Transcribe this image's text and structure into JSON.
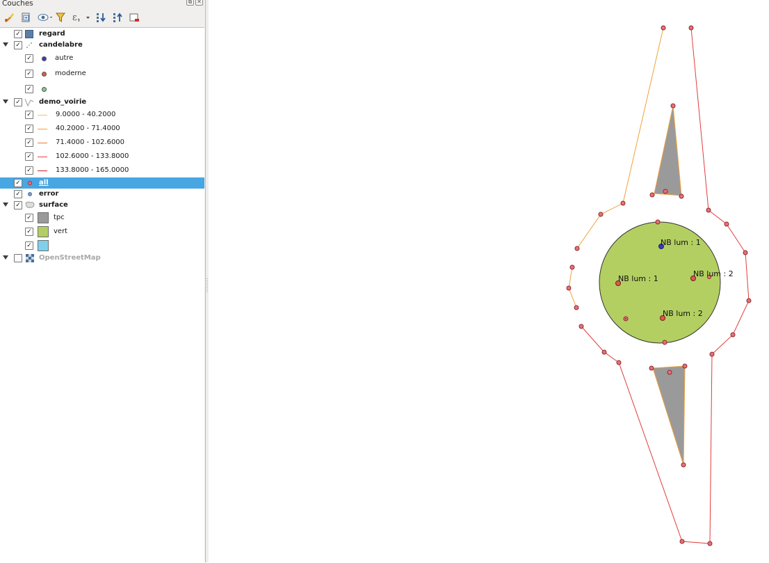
{
  "panel": {
    "title": "Couches",
    "toolbar": [
      {
        "name": "styling-brush-icon"
      },
      {
        "name": "add-group-icon"
      },
      {
        "name": "eye-visibility-icon"
      },
      {
        "name": "filter-funnel-icon"
      },
      {
        "name": "expression-filter-icon"
      },
      {
        "name": "expand-all-icon"
      },
      {
        "name": "collapse-all-icon"
      },
      {
        "name": "remove-layer-icon"
      }
    ]
  },
  "layers": [
    {
      "label": "regard",
      "bold": true,
      "checked": true
    },
    {
      "label": "candelabre",
      "bold": true,
      "checked": true,
      "children": [
        {
          "label": "autre",
          "checked": true,
          "color": "#3c3ab8"
        },
        {
          "label": "moderne",
          "checked": true,
          "color": "#e05a4a"
        },
        {
          "label": "",
          "checked": true,
          "color": "#7ecf8a"
        }
      ]
    },
    {
      "label": "demo_voirie",
      "bold": true,
      "checked": true,
      "children": [
        {
          "label": "9.0000 - 40.2000",
          "checked": true,
          "color": "#f2c84b"
        },
        {
          "label": "40.2000 - 71.4000",
          "checked": true,
          "color": "#f0a03a"
        },
        {
          "label": "71.4000 - 102.6000",
          "checked": true,
          "color": "#ec7a3a"
        },
        {
          "label": "102.6000 - 133.8000",
          "checked": true,
          "color": "#e4453a"
        },
        {
          "label": "133.8000 - 165.0000",
          "checked": true,
          "color": "#d7191c"
        }
      ]
    },
    {
      "label": "all",
      "checked": true,
      "selected": true
    },
    {
      "label": "error",
      "bold": true,
      "checked": true
    },
    {
      "label": "surface",
      "bold": true,
      "checked": true,
      "children": [
        {
          "label": "tpc",
          "checked": true,
          "color": "#9a9a9a"
        },
        {
          "label": "vert",
          "checked": true,
          "color": "#b3cf62"
        },
        {
          "label": "",
          "checked": true,
          "color": "#7fd0ec"
        }
      ]
    },
    {
      "label": "OpenStreetMap",
      "bold": true,
      "checked": false,
      "disabled": true
    }
  ],
  "map": {
    "labels": [
      "NB lum : 1",
      "NB lum : 1",
      "NB lum : 2",
      "NB lum : 2"
    ],
    "colors": {
      "vertex": "#ea6f7a",
      "road_orange": "#f0a03a",
      "road_red": "#e23b3b",
      "circle_fill": "#b3cf62",
      "triangle_fill": "#9a9a9a",
      "selection_blue": "#48a6e2"
    }
  }
}
